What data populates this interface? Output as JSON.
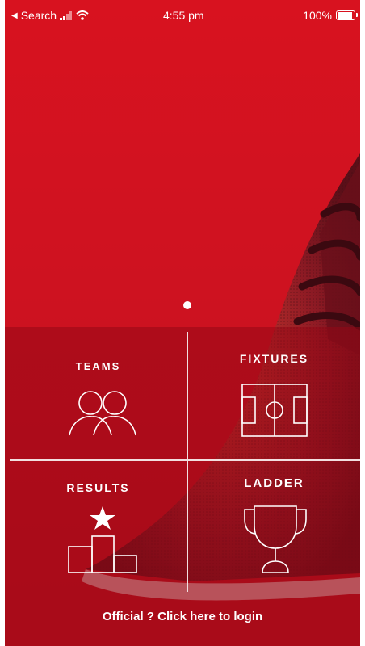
{
  "status_bar": {
    "back_app": "Search",
    "time": "4:55 pm",
    "battery_percent": "100%",
    "battery_level": 1.0
  },
  "carousel": {
    "pages": 1,
    "active_page": 1
  },
  "menu": {
    "teams": "TEAMS",
    "fixtures": "FIXTURES",
    "results": "RESULTS",
    "ladder": "LADDER"
  },
  "login_link": "Official ? Click here to login",
  "colors": {
    "background": "#d8121f",
    "panel": "#9a0816",
    "line": "#f2dfe0",
    "text": "#ffffff"
  },
  "icons": {
    "teams": "people-icon",
    "fixtures": "soccer-field-icon",
    "results": "podium-star-icon",
    "ladder": "trophy-icon"
  }
}
